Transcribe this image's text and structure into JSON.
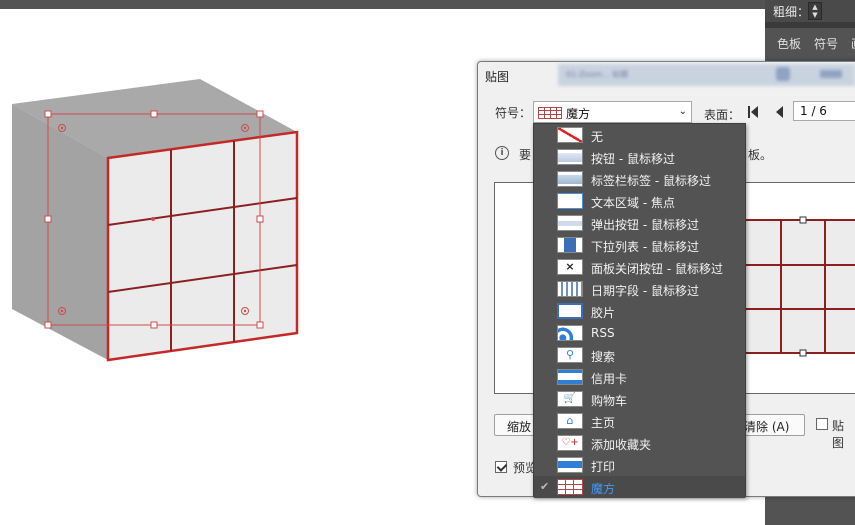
{
  "colors": {
    "accent_red": "#c62828",
    "panel_bg": "#535353",
    "selected_text": "#3d9bff"
  },
  "right_panel": {
    "stroke_label": "粗细：",
    "tabs": [
      "色板",
      "符号",
      "画"
    ]
  },
  "dialog": {
    "title": "贴图",
    "blurred_bar_text": "01-Zoom... 标题",
    "symbol_label": "符号：",
    "symbol_value": "魔方",
    "surface_label": "表面：",
    "page": "1 / 6",
    "info_start": "要",
    "info_end": "板。",
    "scale_button": "缩放",
    "clear_button": "清除 (A)",
    "map_checkbox_label": "贴图",
    "preview_checkbox_label": "预览"
  },
  "dropdown": {
    "items": [
      {
        "label": "无",
        "icon": "none-icon"
      },
      {
        "label": "按钮 - 鼠标移过",
        "icon": "button-icon"
      },
      {
        "label": "标签栏标签 - 鼠标移过",
        "icon": "tab-icon"
      },
      {
        "label": "文本区域 - 焦点",
        "icon": "textarea-icon"
      },
      {
        "label": "弹出按钮 - 鼠标移过",
        "icon": "popup-icon"
      },
      {
        "label": "下拉列表 - 鼠标移过",
        "icon": "dropdown-icon"
      },
      {
        "label": "面板关闭按钮 - 鼠标移过",
        "icon": "close-icon"
      },
      {
        "label": "日期字段 - 鼠标移过",
        "icon": "calendar-icon"
      },
      {
        "label": "胶片",
        "icon": "film-icon"
      },
      {
        "label": "RSS",
        "icon": "rss-icon"
      },
      {
        "label": "搜索",
        "icon": "search-icon"
      },
      {
        "label": "信用卡",
        "icon": "credit-card-icon"
      },
      {
        "label": "购物车",
        "icon": "cart-icon"
      },
      {
        "label": "主页",
        "icon": "home-icon"
      },
      {
        "label": "添加收藏夹",
        "icon": "add-favorite-icon"
      },
      {
        "label": "打印",
        "icon": "print-icon"
      },
      {
        "label": "魔方",
        "icon": "rubik-icon",
        "selected": true
      }
    ]
  }
}
